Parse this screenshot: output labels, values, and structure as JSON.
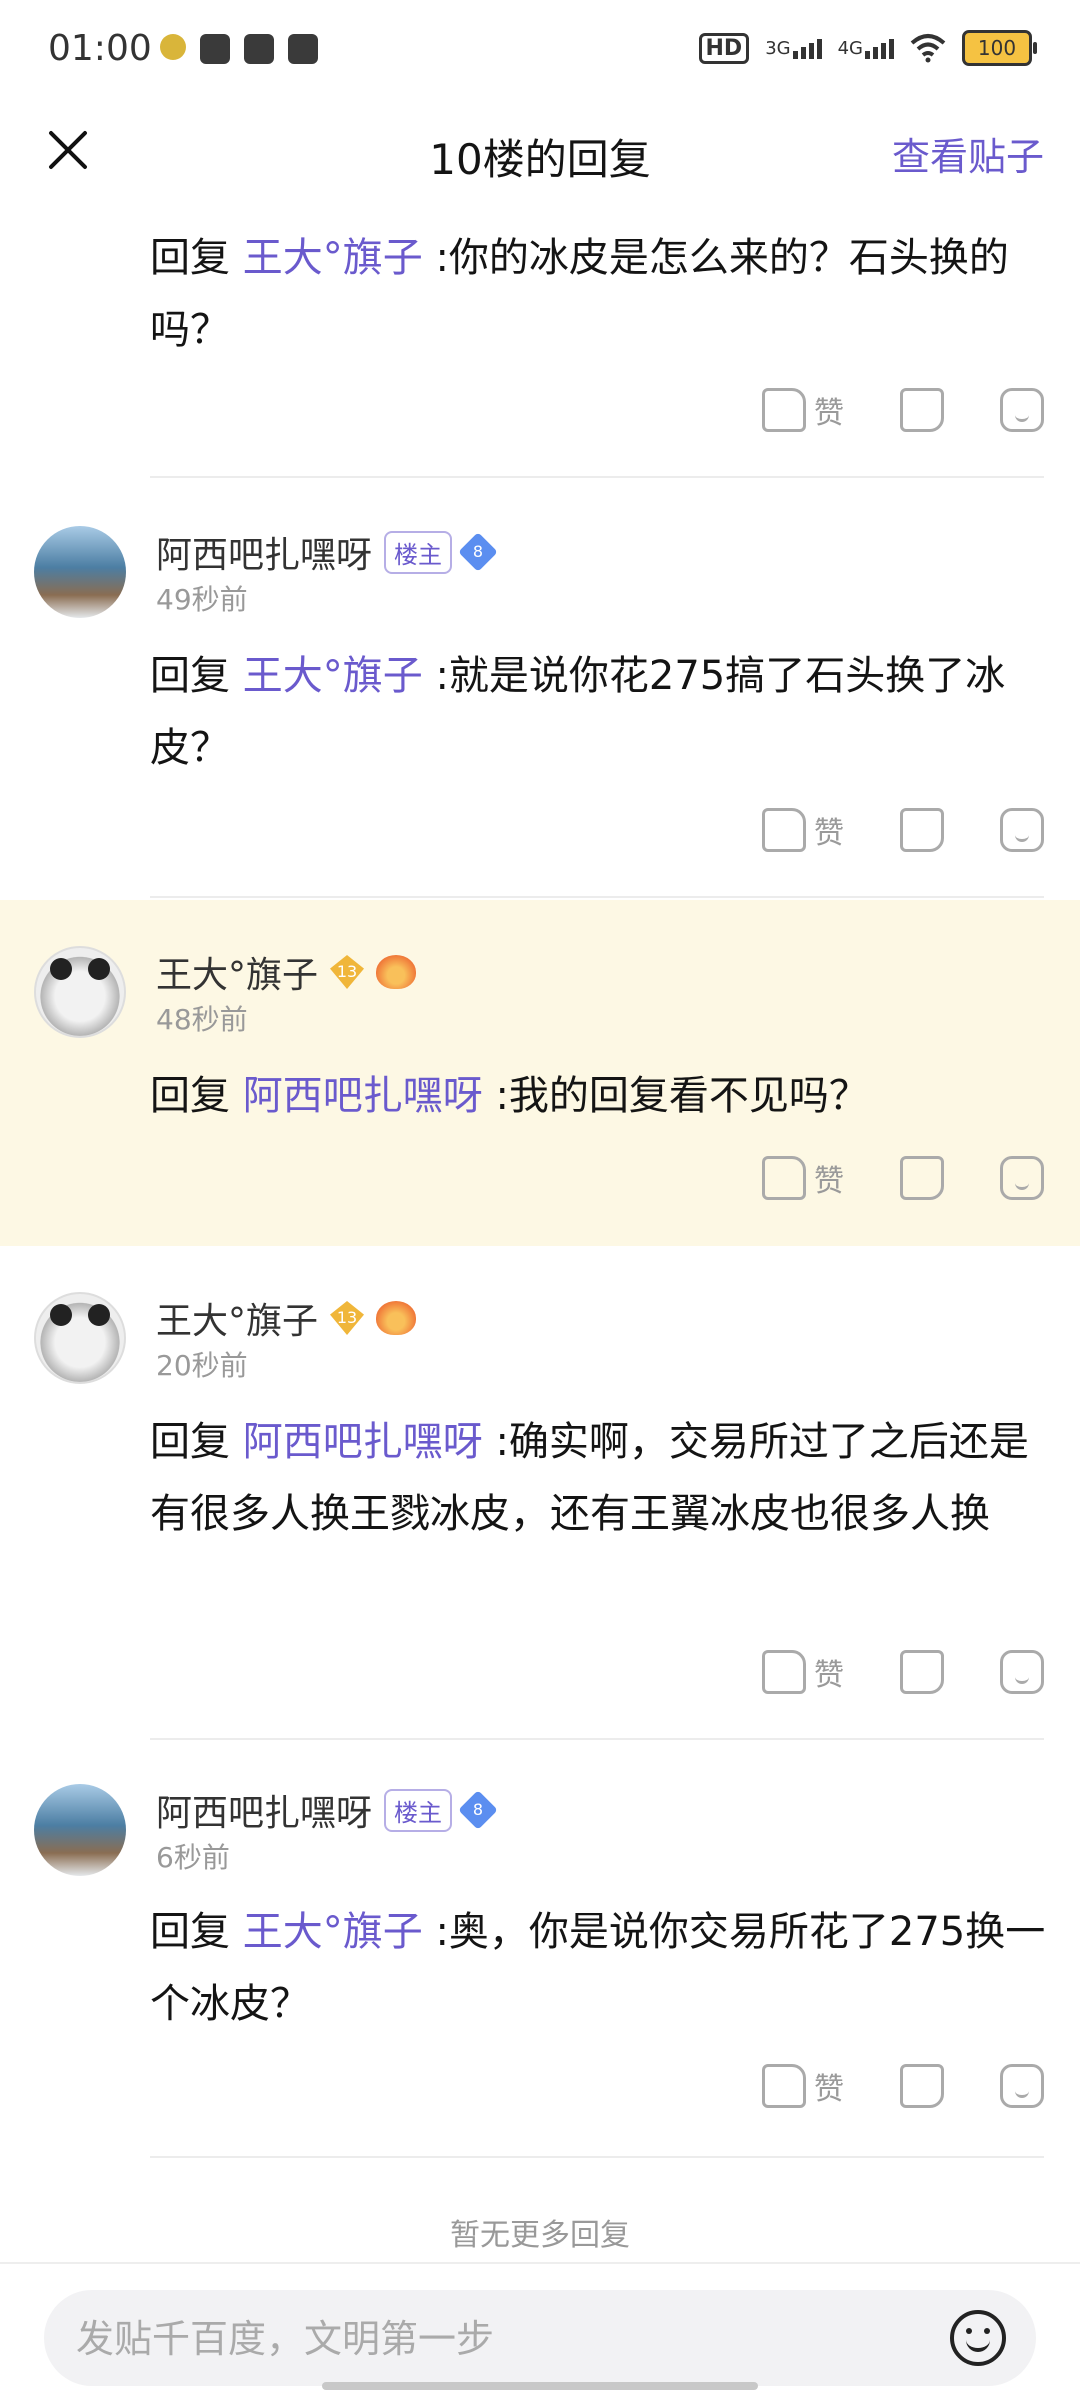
{
  "status_bar": {
    "time": "01:00",
    "network_1": "3G",
    "network_2": "4G",
    "hd_label": "HD",
    "battery": "100"
  },
  "header": {
    "title": "10楼的回复",
    "view_post_label": "查看贴子"
  },
  "common": {
    "reply_prefix": "回复",
    "like_label": "赞",
    "owner_tag": "楼主",
    "gem_level": "8",
    "user_level": "13"
  },
  "comments": [
    {
      "reply_to": "王大°旗子",
      "text": ":你的冰皮是怎么来的？石头换的吗？"
    },
    {
      "username": "阿西吧扎嘿呀",
      "time": "49秒前",
      "reply_to": "王大°旗子",
      "text": ":就是说你花275搞了石头换了冰皮？"
    },
    {
      "username": "王大°旗子",
      "time": "48秒前",
      "reply_to": "阿西吧扎嘿呀",
      "text": ":我的回复看不见吗？"
    },
    {
      "username": "王大°旗子",
      "time": "20秒前",
      "reply_to": "阿西吧扎嘿呀",
      "text": ":确实啊，交易所过了之后还是有很多人换王戮冰皮，还有王翼冰皮也很多人换"
    },
    {
      "username": "阿西吧扎嘿呀",
      "time": "6秒前",
      "reply_to": "王大°旗子",
      "text": ":奥，你是说你交易所花了275换一个冰皮？"
    }
  ],
  "footer": {
    "no_more": "暂无更多回复",
    "input_placeholder": "发贴千百度，文明第一步"
  }
}
